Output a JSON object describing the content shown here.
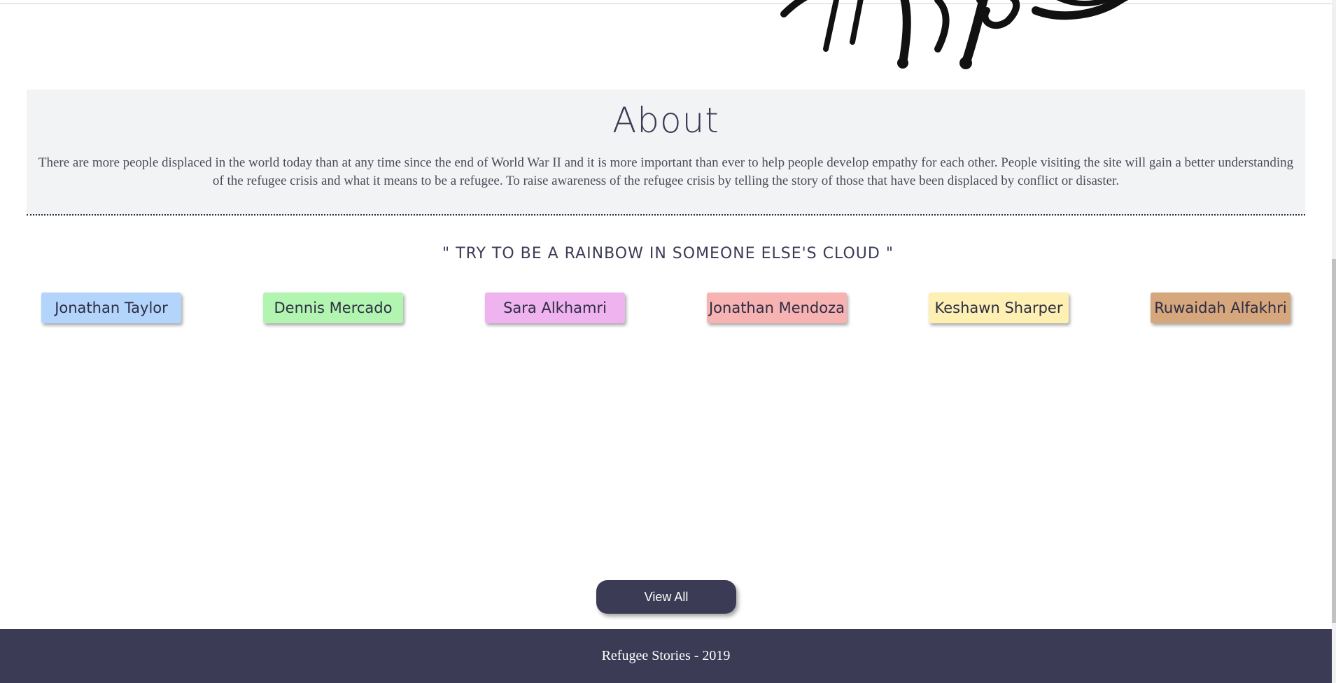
{
  "about": {
    "title": "About",
    "body": "There are more people displaced in the world today than at any time since the end of World War II and it is more important than ever to help people develop empathy for each other. People visiting the site will gain a better understanding of the refugee crisis and what it means to be a refugee. To raise awareness of the refugee crisis by telling the story of those that have been displaced by conflict or disaster."
  },
  "quote": "\" TRY TO BE A RAINBOW IN SOMEONE ELSE'S CLOUD \"",
  "stories": [
    {
      "name": "Jonathan Taylor",
      "color": "#b3d4fb"
    },
    {
      "name": "Dennis Mercado",
      "color": "#b2f5b0"
    },
    {
      "name": "Sara Alkhamri",
      "color": "#efb3ef"
    },
    {
      "name": "Jonathan Mendoza",
      "color": "#f7b2b2"
    },
    {
      "name": "Keshawn Sharper",
      "color": "#fdf0b2"
    },
    {
      "name": "Ruwaidah Alfakhri",
      "color": "#d6a67d"
    }
  ],
  "view_all_label": "View All",
  "footer": "Refugee Stories - 2019",
  "theme": {
    "primary": "#3b3b55",
    "about_bg": "#f2f3f4"
  }
}
